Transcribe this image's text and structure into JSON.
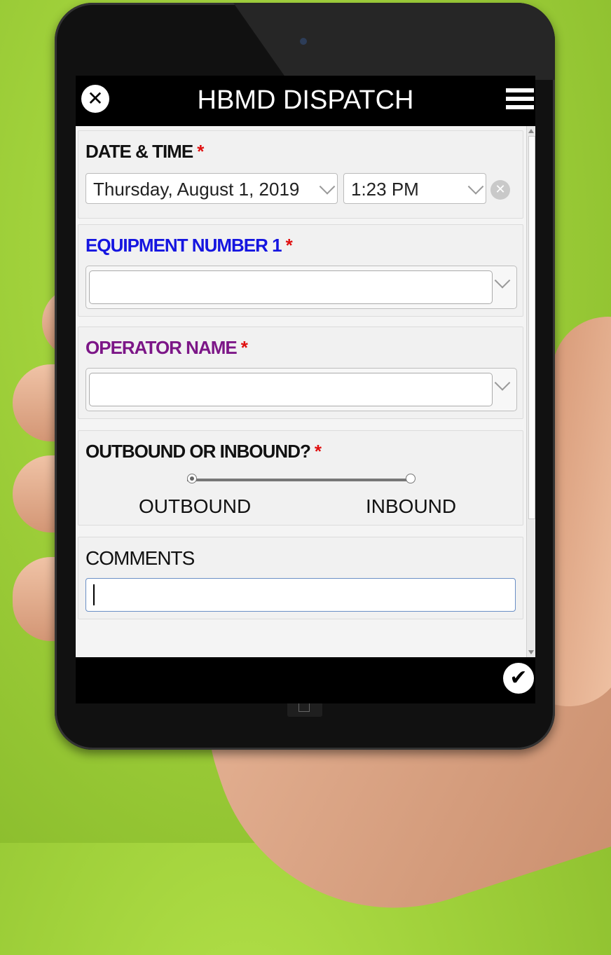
{
  "app": {
    "title": "HBMD DISPATCH",
    "close_icon": "✕",
    "submit_icon": "✔"
  },
  "form": {
    "date_time": {
      "label": "DATE & TIME",
      "required": "*",
      "date_value": "Thursday, August 1, 2019",
      "time_value": "1:23 PM",
      "clear_icon": "✕"
    },
    "equipment": {
      "label": "EQUIPMENT NUMBER 1",
      "required": "*",
      "value": "",
      "label_color": "#1515e0"
    },
    "operator": {
      "label": "OPERATOR NAME",
      "required": "*",
      "value": "",
      "label_color": "#7c1687"
    },
    "direction": {
      "label": "OUTBOUND OR INBOUND?",
      "required": "*",
      "options": [
        "OUTBOUND",
        "INBOUND"
      ],
      "selected": "OUTBOUND"
    },
    "comments": {
      "label": "COMMENTS",
      "value": ""
    }
  },
  "colors": {
    "background": "#9fd03a",
    "required": "#e01010"
  }
}
